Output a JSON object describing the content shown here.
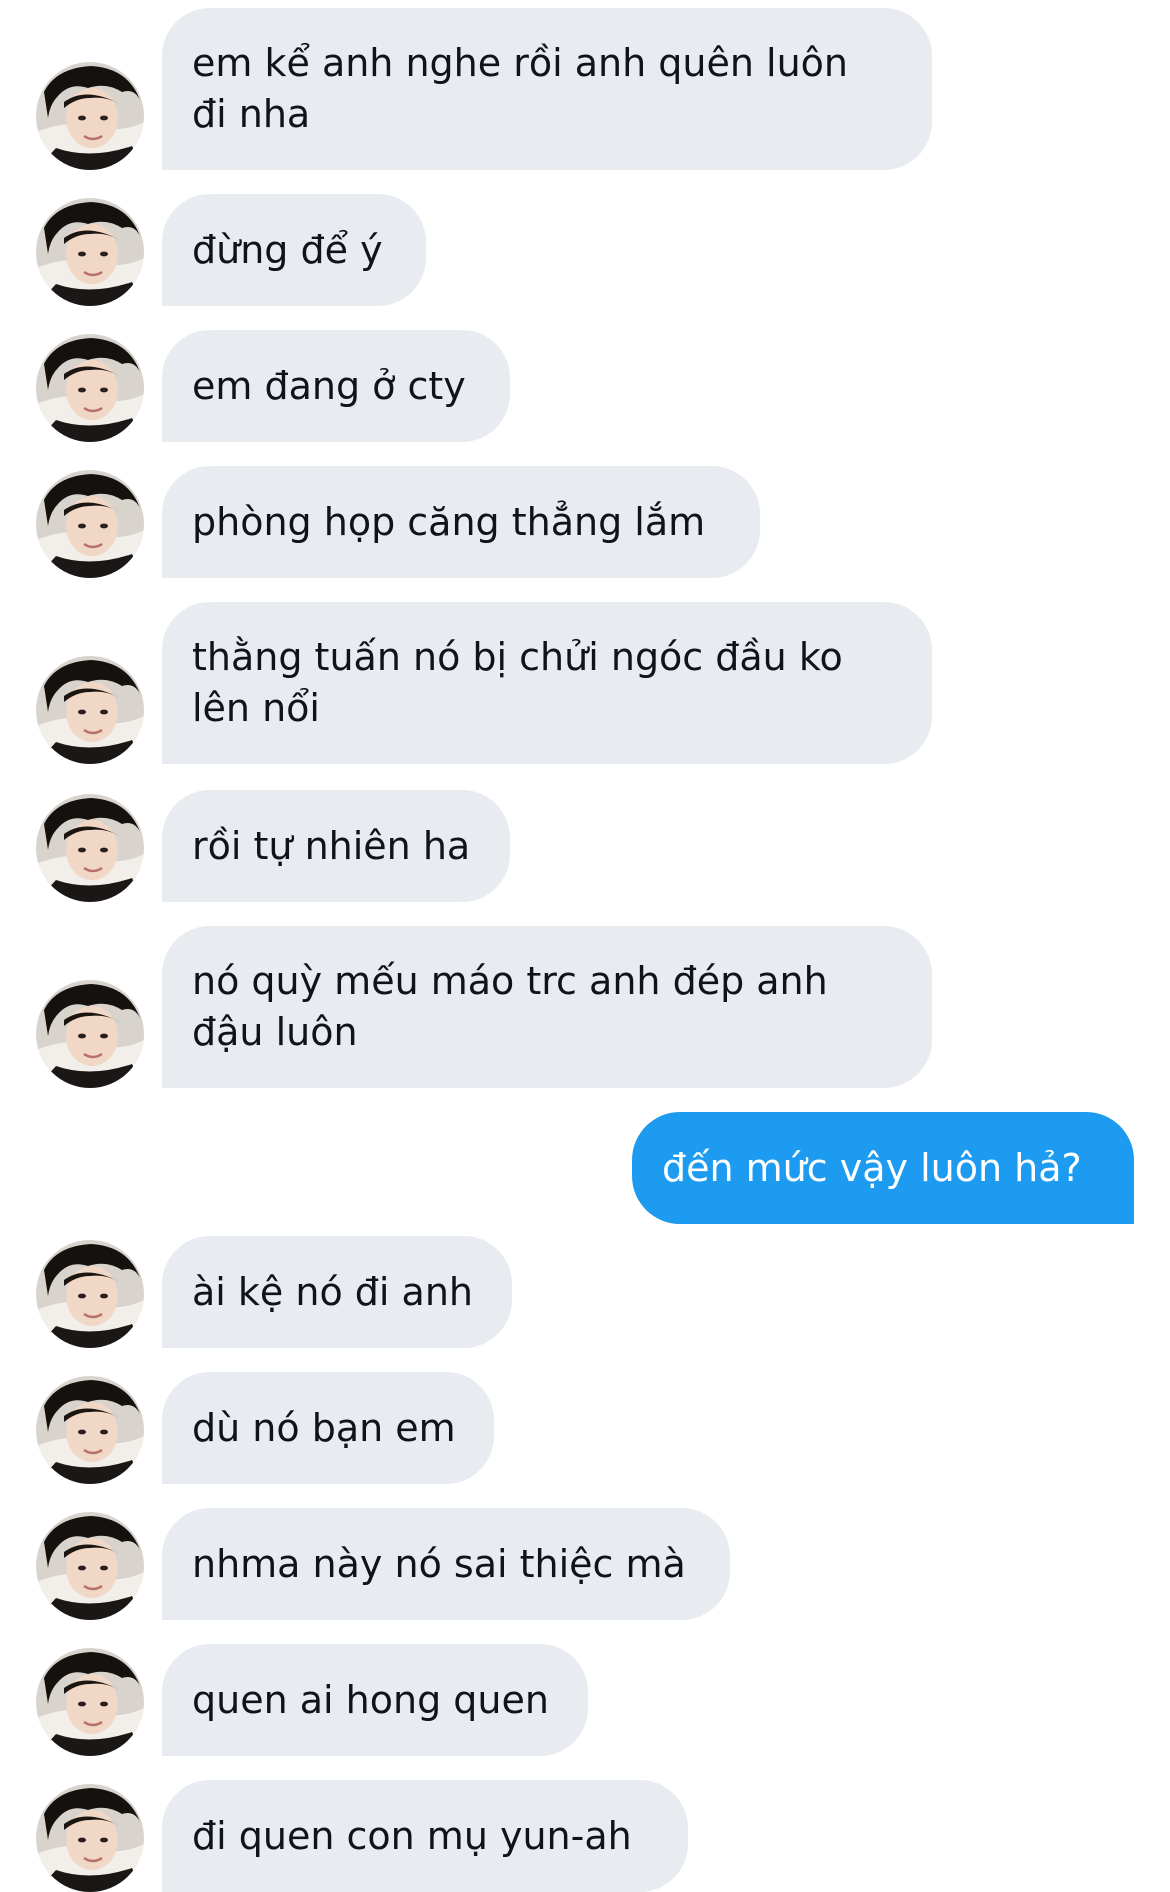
{
  "conversation": {
    "colors": {
      "incoming_bubble": "#e8ecf0",
      "outgoing_bubble": "#1d9bf0",
      "incoming_text": "#0f1419",
      "outgoing_text": "#ffffff"
    },
    "messages": [
      {
        "direction": "incoming",
        "text": "em kể anh nghe rồi anh quên luôn\nđi nha"
      },
      {
        "direction": "incoming",
        "text": "đừng để ý"
      },
      {
        "direction": "incoming",
        "text": "em đang ở cty"
      },
      {
        "direction": "incoming",
        "text": "phòng họp căng thẳng lắm"
      },
      {
        "direction": "incoming",
        "text": "thằng tuấn nó bị chửi ngóc đầu ko\nlên nổi"
      },
      {
        "direction": "incoming",
        "text": "rồi tự nhiên ha"
      },
      {
        "direction": "incoming",
        "text": "nó quỳ mếu máo trc anh đép anh\nđậu luôn"
      },
      {
        "direction": "outgoing",
        "text": "đến mức vậy luôn hả?"
      },
      {
        "direction": "incoming",
        "text": "ài kệ nó đi anh"
      },
      {
        "direction": "incoming",
        "text": "dù nó bạn em"
      },
      {
        "direction": "incoming",
        "text": "nhma này nó sai thiệc mà"
      },
      {
        "direction": "incoming",
        "text": "quen ai hong quen"
      },
      {
        "direction": "incoming",
        "text": "đi quen con mụ yun-ah"
      }
    ]
  }
}
